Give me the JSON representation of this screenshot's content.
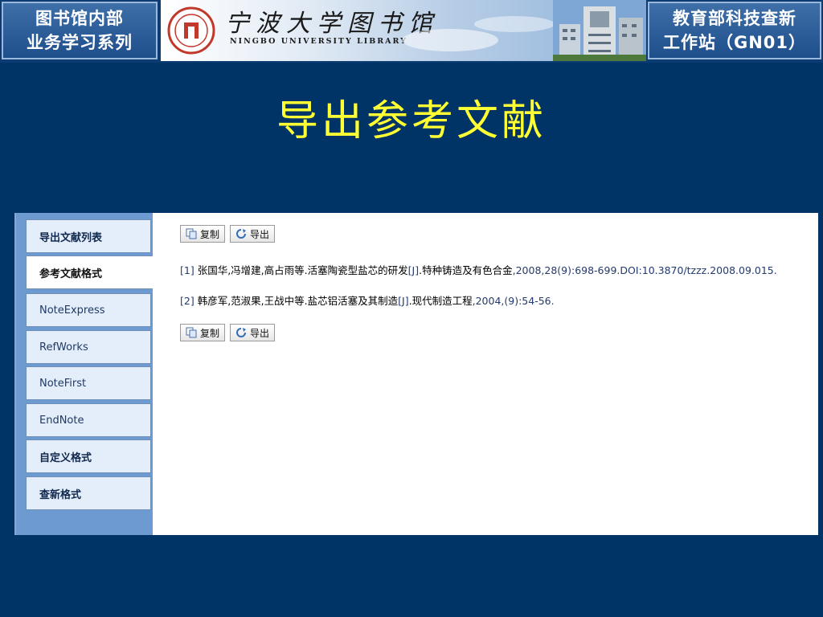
{
  "header": {
    "left_badge": [
      "图书馆内部",
      "业务学习系列"
    ],
    "library_name_cn": "宁波大学图书馆",
    "library_name_en": "NINGBO UNIVERSITY LIBRARY",
    "right_badge": [
      "教育部科技查新",
      "工作站（GN01）"
    ]
  },
  "slide_title": "导出参考文献",
  "sidebar": {
    "items": [
      {
        "label": "导出文献列表",
        "active": false
      },
      {
        "label": "参考文献格式",
        "active": true
      },
      {
        "label": "NoteExpress",
        "active": false
      },
      {
        "label": "RefWorks",
        "active": false
      },
      {
        "label": "NoteFirst",
        "active": false
      },
      {
        "label": "EndNote",
        "active": false
      },
      {
        "label": "自定义格式",
        "active": false
      },
      {
        "label": "查新格式",
        "active": false
      }
    ]
  },
  "toolbar": {
    "copy_label": "复制",
    "export_label": "导出"
  },
  "references": [
    {
      "index": "[1]",
      "authors": "张国华,冯增建,高占雨等",
      "title": "活塞陶瓷型盐芯的研发",
      "type": "[J]",
      "source": "特种铸造及有色合金",
      "details": ",2008,28(9):698-699.DOI:10.3870/tzzz.2008.09.015."
    },
    {
      "index": "[2]",
      "authors": "韩彦军,范淑果,王战中等",
      "title": "盐芯铝活塞及其制造",
      "type": "[J]",
      "source": "现代制造工程",
      "details": ",2004,(9):54-56."
    }
  ],
  "colors": {
    "background": "#003366",
    "title": "#ffff33",
    "sidebar": "#6d9bd1"
  }
}
